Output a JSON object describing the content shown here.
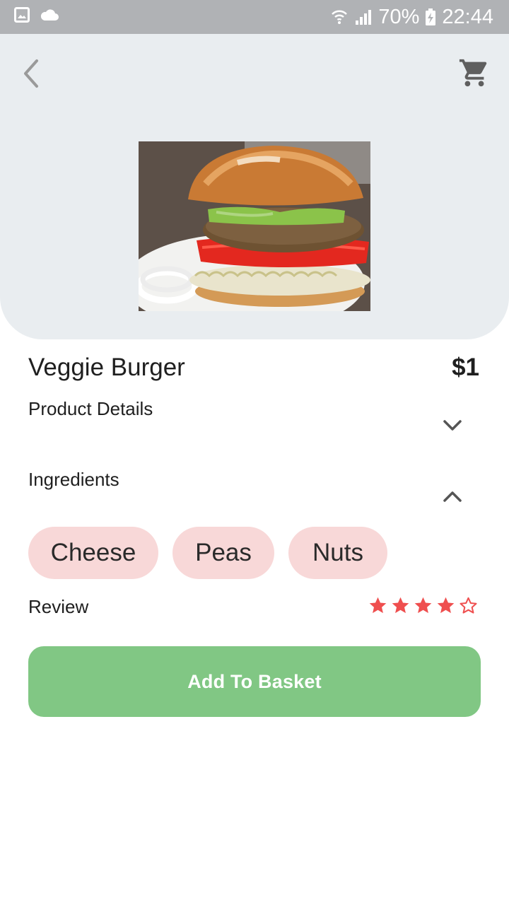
{
  "status_bar": {
    "battery": "70%",
    "time": "22:44"
  },
  "product": {
    "name": "Veggie Burger",
    "price": "$1",
    "image": "veggie-burger-photo"
  },
  "sections": {
    "details_label": "Product Details",
    "ingredients_label": "Ingredients"
  },
  "ingredients": [
    "Cheese",
    "Peas",
    "Nuts"
  ],
  "review": {
    "label": "Review",
    "rating": 4,
    "max": 5
  },
  "actions": {
    "add_to_basket": "Add To Basket"
  },
  "colors": {
    "accent_green": "#81c784",
    "chip_pink": "#f8d8d8",
    "star_red": "#ef4f4f",
    "hero_bg": "#e9edf0"
  }
}
